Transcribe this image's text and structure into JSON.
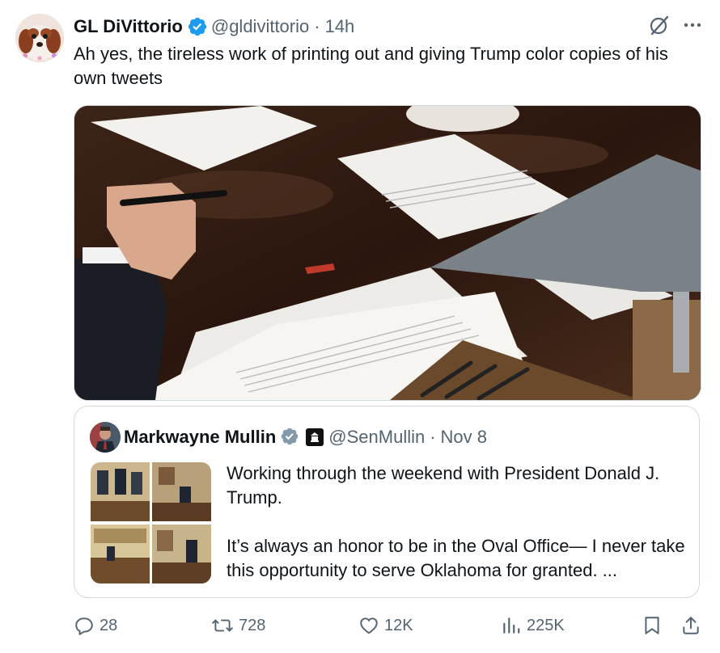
{
  "tweet": {
    "author_name": "GL DiVittorio",
    "handle": "@gldivittorio",
    "separator": "·",
    "time": "14h",
    "text": "Ah yes, the tireless work of printing out and giving Trump color copies of his own tweets"
  },
  "quote": {
    "author_name": "Markwayne Mullin",
    "handle": "@SenMullin",
    "separator": "·",
    "date": "Nov 8",
    "paragraph_1": "Working through the weekend with President Donald J. Trump.",
    "paragraph_2": "It’s always an honor to be in the Oval Office— I never take this opportunity to serve Oklahoma for granted. ..."
  },
  "actions": {
    "replies": "28",
    "reposts": "728",
    "likes": "12K",
    "views": "225K"
  },
  "icons": {
    "verified": "verified-badge-icon",
    "grok": "grok-icon",
    "more": "more-icon",
    "reply": "reply-icon",
    "repost": "repost-icon",
    "like": "like-icon",
    "views": "views-icon",
    "bookmark": "bookmark-icon",
    "share": "share-icon",
    "government": "government-badge-icon"
  },
  "colors": {
    "verified_blue": "#1d9bf0",
    "secondary_text": "#536471",
    "border": "#cfd9de"
  }
}
